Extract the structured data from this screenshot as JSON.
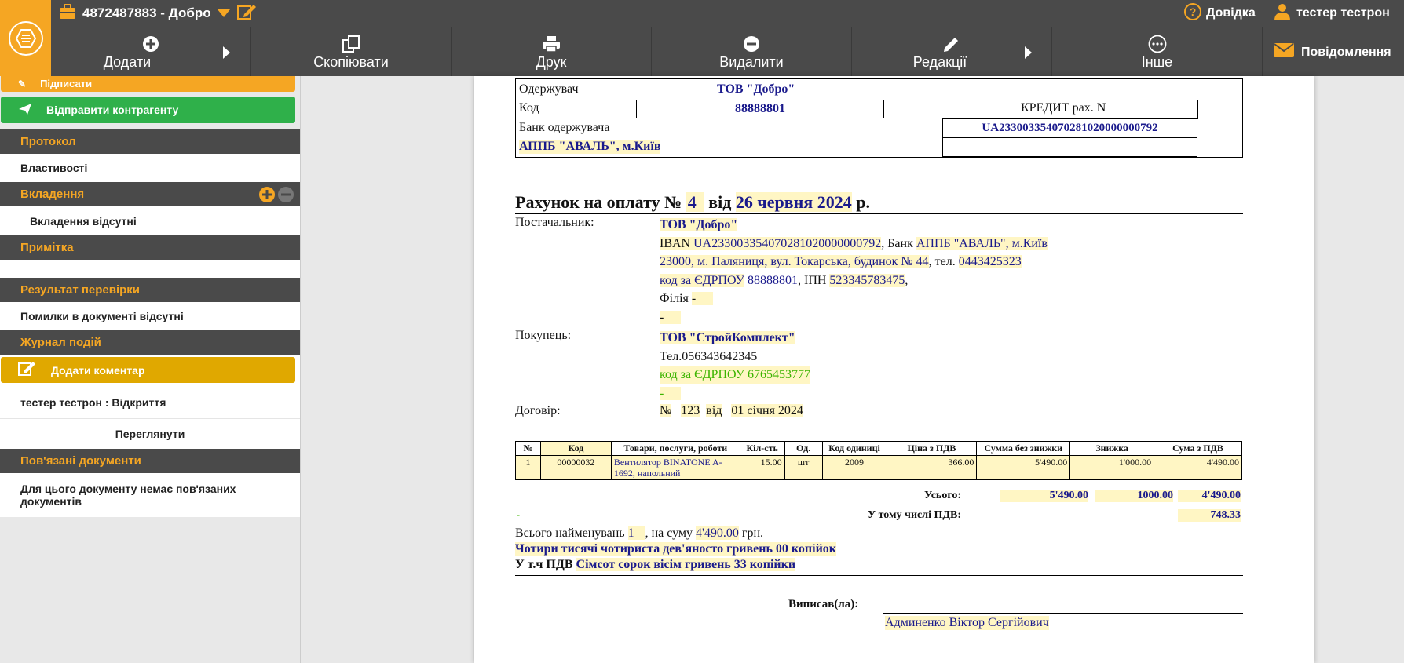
{
  "topbar": {
    "doc_title": "4872487883 - Добро",
    "help_label": "Довідка",
    "user_name": "тестер тестрон"
  },
  "toolbar": {
    "add": "Додати",
    "copy": "Скопіювати",
    "print": "Друк",
    "delete": "Видалити",
    "edit": "Редакції",
    "other": "Інше",
    "messages": "Повідомлення"
  },
  "sidebar": {
    "sign_btn": "Підписати",
    "send_btn": "Відправити контрагенту",
    "protocol_head": "Протокол",
    "properties": "Властивості",
    "attach_head": "Вкладення",
    "attach_none": "Вкладення відсутні",
    "note_head": "Примітка",
    "check_head": "Результат перевірки",
    "check_result": "Помилки в документі відсутні",
    "journal_head": "Журнал подій",
    "add_comment": "Додати коментар",
    "event": "тестер тестрон : Відкриття",
    "view": "Переглянути",
    "related_head": "Пов'язані документи",
    "related_none": "Для цього документу немає пов'язаних документів"
  },
  "colors": {
    "orange": "#f5a623",
    "green": "#2fb04a",
    "yellow": "#e0a800",
    "dark": "#4a4a4a",
    "ink": "#1a1a8c"
  },
  "invoice": {
    "recipient_label": "Одержувач",
    "recipient": "ТОВ \"Добро\"",
    "code_label": "Код",
    "code": "88888801",
    "bank_label": "Банк одержувача",
    "bank": "АППБ \"АВАЛЬ\", м.Київ",
    "credit_label": "КРЕДИТ рах. N",
    "iban": "UA233003354070281020000000792",
    "title_prefix": "Рахунок на оплату №",
    "number": "4",
    "from": "від",
    "date": "26 червня 2024",
    "year_suffix": "р.",
    "supplier_label": "Постачальник:",
    "supplier_name": "ТОВ \"Добро\"",
    "supplier_iban_pre": "IBAN",
    "supplier_iban": "UA233003354070281020000000792",
    "supplier_bank_pre": ", Банк",
    "supplier_bank": "АППБ \"АВАЛЬ\", м.Київ",
    "supplier_addr": "23000, м. Паляниця, вул. Токарська, будинок № 44",
    "supplier_tel_pre": ", тел.",
    "supplier_tel": "0443425323",
    "supplier_edrpou_pre": "код за ЄДРПОУ",
    "supplier_edrpou": "88888801",
    "supplier_ipn_pre": ", ІПН",
    "supplier_ipn": "523345783475",
    "supplier_ipn_post": ",",
    "branch_pre": "Філія",
    "dash": "-",
    "buyer_label": "Покупець:",
    "buyer_name": "ТОВ \"СтройКомплект\"",
    "buyer_tel": "Тел.056343642345",
    "buyer_edrpou_pre": "код за ЄДРПОУ",
    "buyer_edrpou": "6765453777",
    "contract_label": "Договір:",
    "contract_no_pre": "№",
    "contract_no": "123",
    "contract_from": "від",
    "contract_date": "01 січня 2024",
    "table_headers": [
      "№",
      "Код",
      "Товари, послуги, роботи",
      "Кіл-сть",
      "Од.",
      "Код одиниці",
      "Ціна з ПДВ",
      "Сумма без знижки",
      "Знижка",
      "Сума з ПДВ"
    ],
    "rows": [
      {
        "n": "1",
        "code": "00000032",
        "name": "Вентилятор BINATONE A-1692, напольний",
        "qty": "15.00",
        "unit": "шт",
        "unit_code": "2009",
        "price": "366.00",
        "sum_no_disc": "5'490.00",
        "disc": "1'000.00",
        "sum": "4'490.00"
      }
    ],
    "total_label": "Усього:",
    "total_no_disc": "5'490.00",
    "total_disc": "1000.00",
    "total_sum": "4'490.00",
    "vat_label": "У тому числі ПДВ:",
    "vat": "748.33",
    "count_pre": "Всього найменувань",
    "count": "1",
    "count_mid": ", на суму",
    "count_sum": "4'490.00",
    "count_post": "грн.",
    "words": "Чотири тисячі чотириста дев'яносто гривень 00 копійок",
    "vat_words_pre": "У т.ч ПДВ",
    "vat_words": "Сімсот сорок вісім гривень 33 копійки",
    "issued_label": "Виписав(ла):",
    "issuer": "Админенко Віктор Сергійович"
  }
}
